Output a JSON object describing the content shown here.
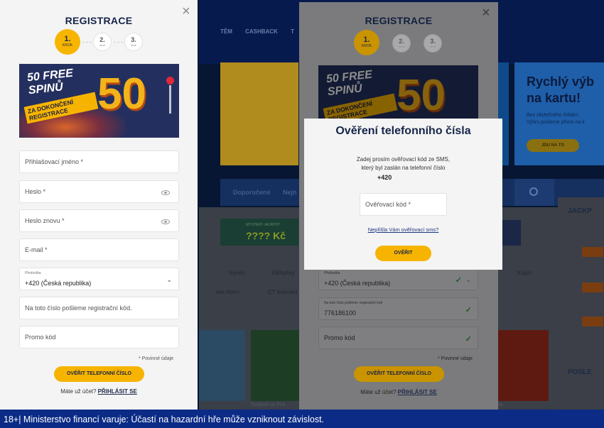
{
  "background": {
    "nav": [
      "TĚM",
      "CASHBACK",
      "T"
    ],
    "banner_right": {
      "title_line1": "Rychlý výb",
      "title_line2": "na kartu!",
      "text_line1": "Bez zbytečného čekání.",
      "text_line2": "Výhru pošleme přímo na k",
      "button": "JDU NA TO"
    },
    "tabs": [
      "Doporučené",
      "Nejn"
    ],
    "jackpot_label": "MYSTERY JACKPOT",
    "jackpot_value": "???? Kč",
    "providers": [
      "Synot",
      "ABXplay",
      "Kajot",
      "om Horn",
      "CT Interact"
    ],
    "game_name": "Football on Fire",
    "game_name_right": "uits",
    "right_titles": [
      "JACKP",
      "POSLE"
    ]
  },
  "left_panel": {
    "title": "REGISTRACE",
    "steps": [
      {
        "num": "1.",
        "sub": "KROK"
      },
      {
        "num": "2.",
        "sub": "krok"
      },
      {
        "num": "3.",
        "sub": "krok"
      }
    ],
    "promo": {
      "line1": "50 FREE",
      "line2": "SPINŮ",
      "ribbon1": "ZA DOKONČENÍ",
      "ribbon2": "REGISTRACE",
      "big": "50"
    },
    "fields": {
      "login": "Přihlašovací jméno *",
      "password": "Heslo *",
      "password_again": "Heslo znovu *",
      "email": "E-mail *",
      "prefix_label": "Předvolba",
      "prefix_value": "+420 (Česká republika)",
      "phone": "Na toto číslo pošleme registrační kód.",
      "promo_code": "Promo kód"
    },
    "required_note": "* Povinné údaje",
    "verify_button": "OVĚŘIT TELEFONNÍ ČÍSLO",
    "has_account": "Máte už účet?",
    "login_link": "PŘIHLÁSIT SE"
  },
  "right_panel": {
    "title": "REGISTRACE",
    "steps": [
      {
        "num": "1.",
        "sub": "KROK"
      },
      {
        "num": "2.",
        "sub": "krok"
      },
      {
        "num": "3.",
        "sub": "krok"
      }
    ],
    "prefix_label": "Předvolba",
    "prefix_value": "+420 (Česká republika)",
    "phone_label": "Na toto číslo pošleme registrační kód",
    "phone_value": "776186100",
    "promo_code": "Promo kód",
    "required_note": "* Povinné údaje",
    "verify_button": "OVĚŘIT TELEFONNÍ ČÍSLO",
    "has_account": "Máte už účet?",
    "login_link": "PŘIHLÁSIT SE"
  },
  "sms_dialog": {
    "title": "Ověření telefonního čísla",
    "text_line1": "Zadej prosím ověřovací kód ze SMS,",
    "text_line2": "který byl zaslán na telefonní číslo",
    "phone_prefix": "+420",
    "code_placeholder": "Ověřovací kód *",
    "resend_link": "Nepřišla Vám ověřovací sms?",
    "verify_button": "OVĚŘIT"
  },
  "footer": {
    "warning": "18+| Ministerstvo financí varuje: Účastí na hazardní hře může vzniknout závislost."
  },
  "colors": {
    "accent": "#f6b400",
    "navy": "#16254a",
    "footer_bg": "#0b2b86"
  }
}
